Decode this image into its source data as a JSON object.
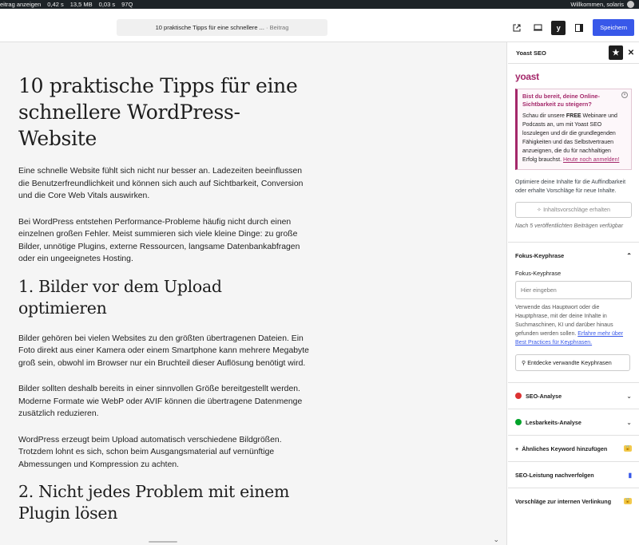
{
  "adminbar": {
    "left_items": [
      "eitrag anzeigen",
      "0,42 s",
      "13,5 MB",
      "0,03 s",
      "97Q"
    ],
    "greeting": "Willkommen, solaris"
  },
  "topbar": {
    "doc_title": "10 praktische Tipps für eine schnellere ...",
    "doc_type": "· Beitrag",
    "save_label": "Speichern",
    "icons": [
      "external-link-icon",
      "desktop-preview-icon",
      "yoast-icon",
      "sidebar-toggle-icon",
      "more-options-icon"
    ]
  },
  "article": {
    "title": "10 praktische Tipps für eine schnellere WordPress-Website",
    "p1": "Eine schnelle Website fühlt sich nicht nur besser an. Ladezeiten beeinflussen die Benutzerfreundlichkeit und können sich auch auf Sichtbarkeit, Conversion und die Core Web Vitals auswirken.",
    "p2": "Bei WordPress entstehen Performance-Probleme häufig nicht durch einen einzelnen großen Fehler. Meist summieren sich viele kleine Dinge: zu große Bilder, unnötige Plugins, externe Ressourcen, langsame Datenbankabfragen oder ein ungeeignetes Hosting.",
    "h2_1": "1. Bilder vor dem Upload optimieren",
    "p3": "Bilder gehören bei vielen Websites zu den größten übertragenen Dateien. Ein Foto direkt aus einer Kamera oder einem Smartphone kann mehrere Megabyte groß sein, obwohl im Browser nur ein Bruchteil dieser Auflösung benötigt wird.",
    "p4": "Bilder sollten deshalb bereits in einer sinnvollen Größe bereitgestellt werden. Moderne Formate wie WebP oder AVIF können die übertragene Datenmenge zusätzlich reduzieren.",
    "p5": "WordPress erzeugt beim Upload automatisch verschiedene Bildgrößen. Trotzdem lohnt es sich, schon beim Ausgangsmaterial auf vernünftige Abmessungen und Kompression zu achten.",
    "h2_2": "2. Nicht jedes Problem mit einem Plugin lösen"
  },
  "sidebar": {
    "title": "Yoast SEO",
    "logo_text": "yoast",
    "promo": {
      "heading": "Bist du bereit, deine Online-Sichtbarkeit zu steigern?",
      "body_before": "Schau dir unsere ",
      "body_bold": "FREE",
      "body_after": " Webinare und Podcasts an, um mit Yoast SEO loszulegen und dir die grundlegenden Fähigkeiten und das Selbstvertrauen anzueignen, die du für nachhaltigen Erfolg brauchst. ",
      "link": "Heute noch anmelden!"
    },
    "optimize_text": "Optimiere deine Inhalte für die Auffindbarkeit oder erhalte Vorschläge für neue Inhalte.",
    "suggestions_button": "Inhaltsvorschläge erhalten",
    "posts_note": "Nach 5 veröffentlichten Beiträgen verfügbar",
    "focus_section": "Fokus-Keyphrase",
    "focus_label": "Fokus-Keyphrase",
    "focus_placeholder": "Hier eingeben",
    "focus_help": "Verwende das Hauptwort oder die Hauptphrase, mit der deine Inhalte in Suchmaschinen, KI und darüber hinaus gefunden werden sollen. ",
    "focus_link": "Erfahre mehr über Best Practices für Keyphrasen.",
    "related_button": "Entdecke verwandte Keyphrasen",
    "seo_analysis": "SEO-Analyse",
    "readability": "Lesbarkeits-Analyse",
    "similar_keyword": "Ähnliches Keyword hinzufügen",
    "seo_tracking": "SEO-Leistung nachverfolgen",
    "internal_links": "Vorschläge zur internen Verlinkung",
    "colors": {
      "seo_status": "#dc3232",
      "readability_status": "#00a32a",
      "accent": "#a4286a"
    }
  }
}
